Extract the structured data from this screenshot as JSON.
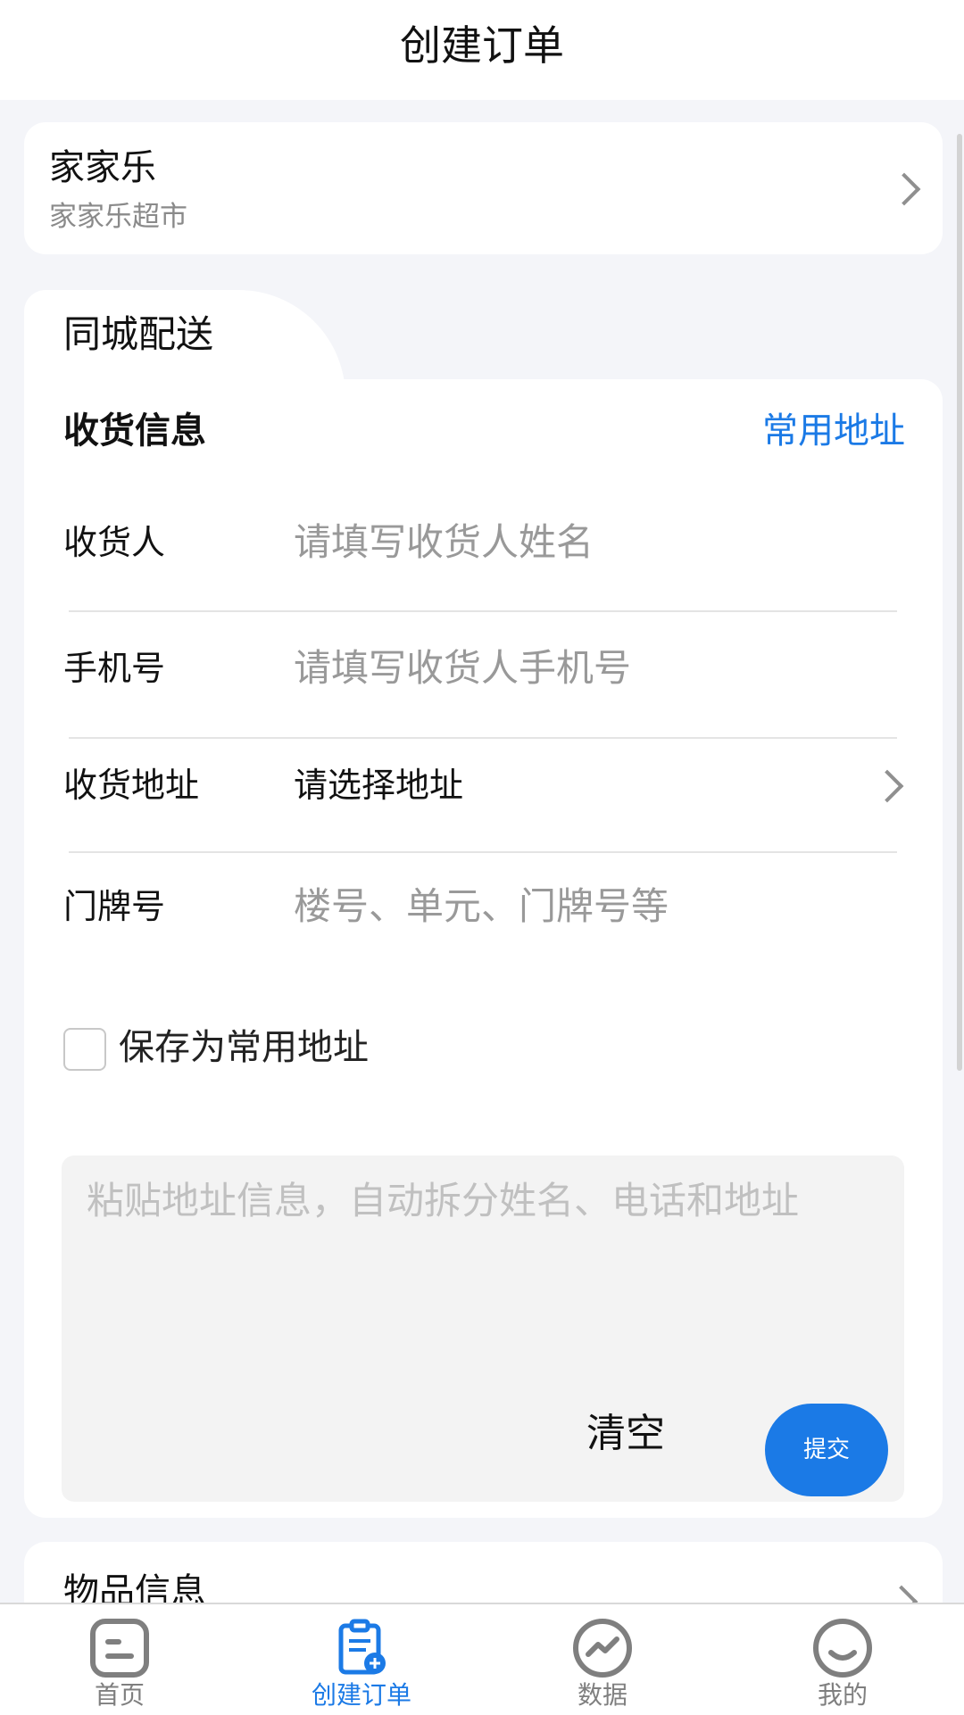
{
  "header": {
    "title": "创建订单"
  },
  "merchant": {
    "name": "家家乐",
    "subtitle": "家家乐超市"
  },
  "delivery": {
    "tab_label": "同城配送",
    "section_title": "收货信息",
    "common_address_link": "常用地址",
    "fields": {
      "recipient": {
        "label": "收货人",
        "placeholder": "请填写收货人姓名"
      },
      "phone": {
        "label": "手机号",
        "placeholder": "请填写收货人手机号"
      },
      "address": {
        "label": "收货地址",
        "value": "请选择地址"
      },
      "door": {
        "label": "门牌号",
        "placeholder": "楼号、单元、门牌号等"
      }
    },
    "save_as_common": "保存为常用地址",
    "paste": {
      "placeholder": "粘贴地址信息，自动拆分姓名、电话和地址",
      "clear_label": "清空",
      "submit_label": "提交"
    }
  },
  "goods": {
    "label": "物品信息"
  },
  "tabbar": {
    "items": [
      {
        "label": "首页",
        "icon": "home-icon"
      },
      {
        "label": "创建订单",
        "icon": "create-order-icon"
      },
      {
        "label": "数据",
        "icon": "data-icon"
      },
      {
        "label": "我的",
        "icon": "profile-icon"
      }
    ],
    "active_index": 1,
    "active_color": "#1b7ae6",
    "inactive_color": "#7f7f7f"
  }
}
